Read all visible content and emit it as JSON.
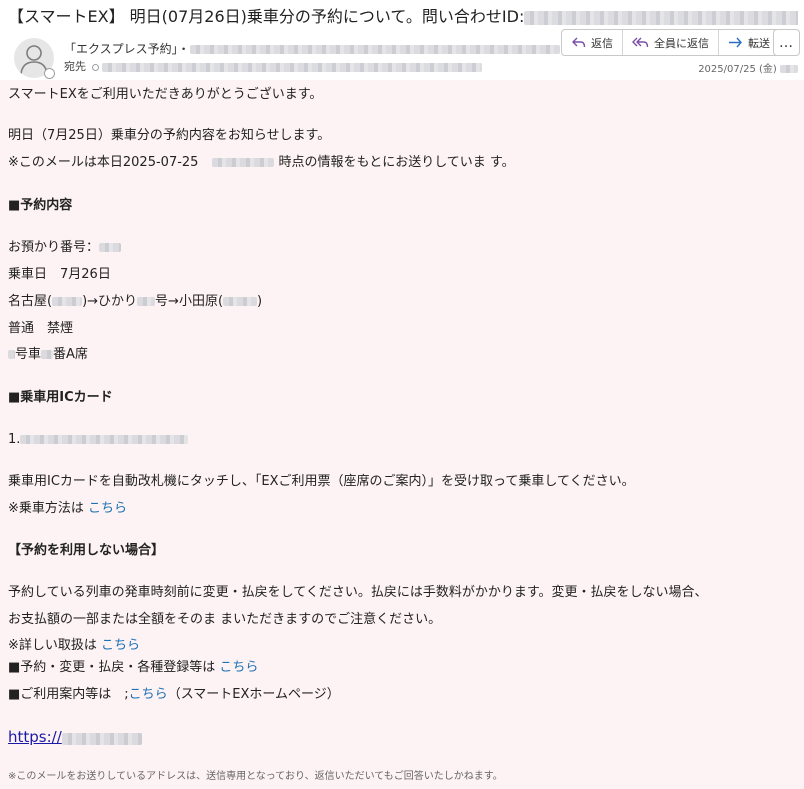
{
  "subject": {
    "prefix": "【スマートEX】 明日(07月26日)乗車分の予約について。問い合わせID:"
  },
  "sender": {
    "name": "「エクスプレス予約」"
  },
  "recipients": {
    "label": "宛先"
  },
  "actions": {
    "reply": "返信",
    "reply_all": "全員に返信",
    "forward": "転送",
    "more": "…"
  },
  "date": {
    "value": "2025/07/25 (金)"
  },
  "body": {
    "greeting": "スマートEXをご利用いただきありがとうございます。",
    "notice": "明日（7月25日）乗車分の予約内容をお知らせします。",
    "info_prefix": "※このメールは本日2025-07-25",
    "info_suffix": "時点の情報をもとにお送りしていま す。",
    "section_reservation": "■予約内容",
    "reservation_no_label": "お預かり番号：",
    "ride_date": "乗車日　7月26日",
    "route_from": "名古屋(",
    "route_mid1": ")→ひかり",
    "route_mid2": "号→小田原(",
    "route_end": ")",
    "seat_class": "普通　禁煙",
    "car_suffix": "号車",
    "seat_suffix": "番A席",
    "section_ic": "■乗車用ICカード",
    "ic_index": "1.",
    "ic_instruction": "乗車用ICカードを自動改札機にタッチし、「EXご利用票（座席のご案内）」を受け取って乗車してください。",
    "ride_method_prefix": "※乗車方法は ",
    "link_here": "こちら",
    "section_no_use": "【予約を利用しない場合】",
    "cancel_line1": "予約している列車の発車時刻前に変更・払戻をしてください。払戻には手数料がかかります。変更・払戻をしない場合、",
    "cancel_line2": "お支払額の一部または全額をそのま まいただきますのでご注意ください。",
    "details_prefix": "※詳しい取扱は ",
    "change_prefix": "■予約・変更・払戻・各種登録等は ",
    "guide_prefix": "■ご利用案内等は　;",
    "guide_suffix": "（スマートEXホームページ）",
    "url_prefix": "https://",
    "footer": "※このメールをお送りしているアドレスは、送信専用となっており、返信いただいてもご回答いたしかねます。"
  }
}
